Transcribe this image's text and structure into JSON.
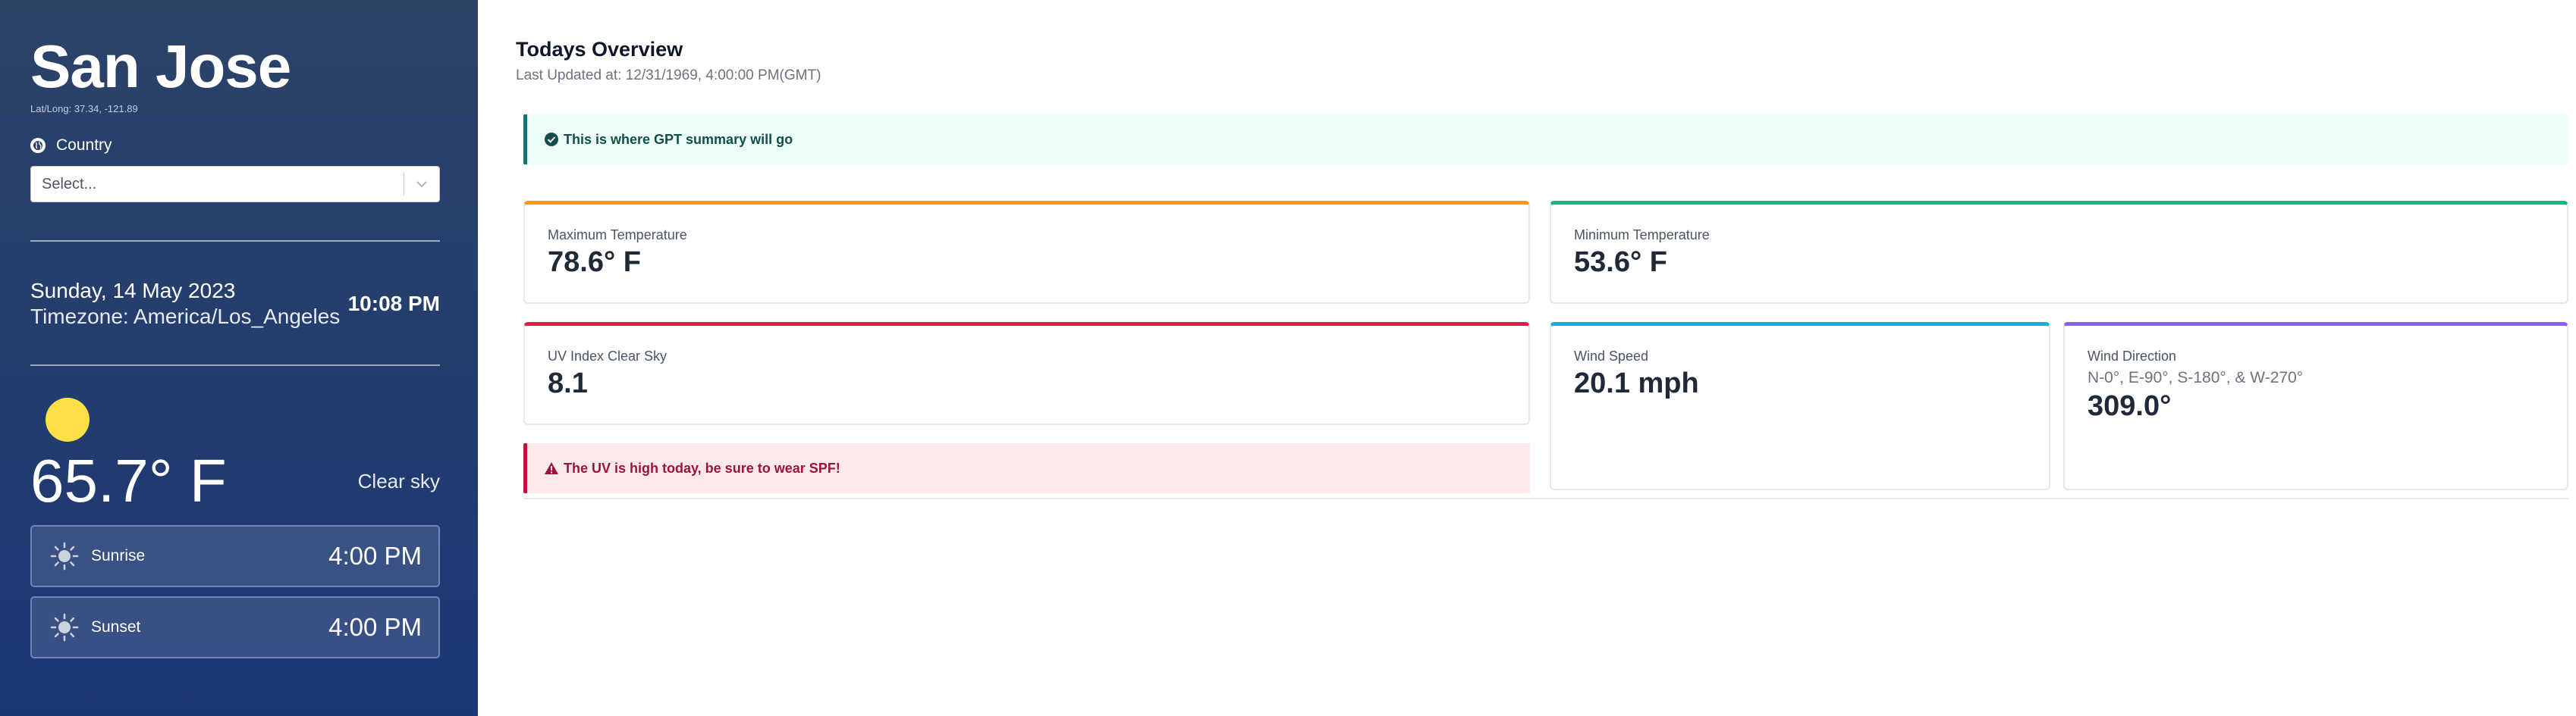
{
  "sidebar": {
    "city": "San Jose",
    "latlong": "Lat/Long: 37.34, -121.89",
    "country_label": "Country",
    "country_select_placeholder": "Select...",
    "date": "Sunday, 14 May 2023",
    "timezone": "Timezone: America/Los_Angeles",
    "time": "10:08 PM",
    "temperature": "65.7° F",
    "condition": "Clear sky",
    "sunrise_label": "Sunrise",
    "sunrise_time": "4:00 PM",
    "sunset_label": "Sunset",
    "sunset_time": "4:00 PM"
  },
  "main": {
    "title": "Todays Overview",
    "last_updated": "Last Updated at: 12/31/1969, 4:00:00 PM(GMT)",
    "summary_alert": "This is where GPT summary will go",
    "uv_warning": "The UV is high today, be sure to wear SPF!",
    "cards": {
      "max_temp": {
        "label": "Maximum Temperature",
        "value": "78.6° F"
      },
      "min_temp": {
        "label": "Minimum Temperature",
        "value": "53.6° F"
      },
      "uv": {
        "label": "UV Index Clear Sky",
        "value": "8.1"
      },
      "wind_speed": {
        "label": "Wind Speed",
        "value": "20.1 mph"
      },
      "wind_dir": {
        "label": "Wind Direction",
        "sub": "N-0°, E-90°, S-180°, & W-270°",
        "value": "309.0°"
      }
    }
  },
  "colors": {
    "max_accent": "#f59e0b",
    "min_accent": "#10b981",
    "uv_accent": "#e11d48",
    "wind_accent": "#06b6d4",
    "dir_accent": "#8b5cf6",
    "sun": "#fde047"
  },
  "icons": [
    "globe-icon",
    "chevron-down-icon",
    "sun-icon",
    "check-circle-icon",
    "warning-triangle-icon"
  ]
}
